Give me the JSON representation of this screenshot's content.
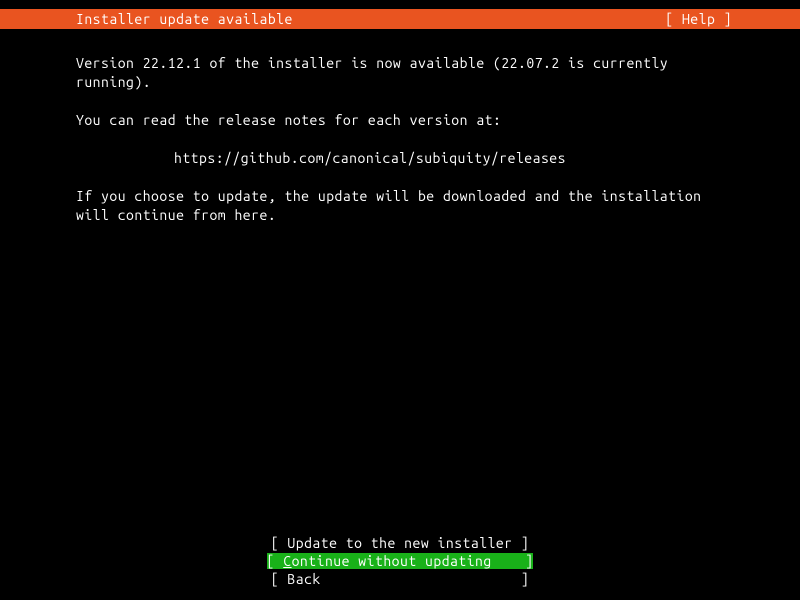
{
  "header": {
    "title": "Installer update available",
    "help_label": "[ Help ]"
  },
  "body": {
    "line1": "Version 22.12.1 of the installer is now available (22.07.2 is currently running).",
    "line2": "You can read the release notes for each version at:",
    "url": "https://github.com/canonical/subiquity/releases",
    "line3": "If you choose to update, the update will be downloaded and the installation will continue from here."
  },
  "buttons": {
    "update": {
      "open": "[ ",
      "label": "Update to the new installer",
      "close": " ]"
    },
    "continue": {
      "open": "[ ",
      "first_char": "C",
      "rest": "ontinue without updating   ",
      "close": " ]"
    },
    "back": {
      "open": "[ ",
      "label": "Back                       ",
      "close": " ]"
    }
  }
}
